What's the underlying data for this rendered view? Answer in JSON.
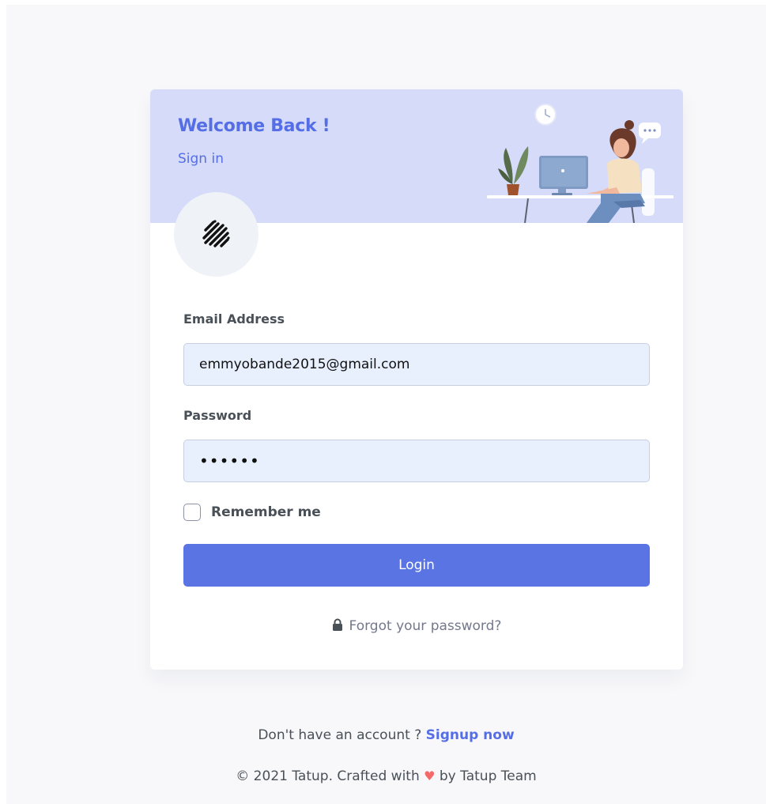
{
  "hero": {
    "title": "Welcome Back !",
    "subtitle": "Sign in"
  },
  "form": {
    "email_label": "Email Address",
    "email_value": "emmyobande2015@gmail.com",
    "password_label": "Password",
    "password_value": "••••••",
    "remember_label": "Remember me",
    "remember_checked": false,
    "login_label": "Login",
    "forgot_label": "Forgot your password?",
    "forgot_icon": "lock-icon"
  },
  "footer": {
    "no_account_text": "Don't have an account ? ",
    "signup_label": "Signup now",
    "copyright_prefix": "© 2021 Tatup. Crafted with ",
    "heart_icon": "♥",
    "copyright_suffix": " by Tatup Team"
  },
  "colors": {
    "accent": "#556ee6",
    "hero_bg": "#d5dbf8",
    "button_bg": "#5a74e3",
    "input_bg": "#e8f0fe",
    "heart": "#f46a6a"
  }
}
